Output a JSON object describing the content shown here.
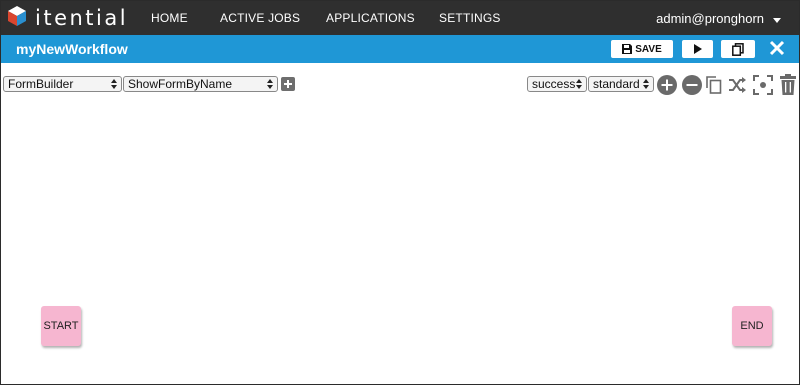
{
  "brand": {
    "name": "itential"
  },
  "nav": {
    "items": [
      {
        "label": "HOME"
      },
      {
        "label": "ACTIVE JOBS"
      },
      {
        "label": "APPLICATIONS"
      },
      {
        "label": "SETTINGS"
      }
    ],
    "user": "admin@pronghorn",
    "user_icon": "chevron-down-icon"
  },
  "workflow": {
    "title": "myNewWorkflow",
    "save_label": "SAVE",
    "save_icon": "floppy-disk-icon",
    "run_icon": "play-icon",
    "copy_icon": "copy-icon",
    "close_icon": "close-icon"
  },
  "toolbar": {
    "app_select": "FormBuilder",
    "task_select": "ShowFormByName",
    "add_task_icon": "plus-square-icon",
    "status_select": "success",
    "transition_select": "standard",
    "tools": [
      "zoom-in-icon",
      "zoom-out-icon",
      "duplicate-icon",
      "shuffle-icon",
      "fit-screen-icon",
      "trash-icon"
    ]
  },
  "canvas": {
    "start_label": "START",
    "end_label": "END"
  },
  "colors": {
    "topnav": "#2f2f2f",
    "header": "#1f97d6",
    "node": "#f6b6d0",
    "logo_red": "#d9462f",
    "logo_blue": "#2a8fcf"
  }
}
